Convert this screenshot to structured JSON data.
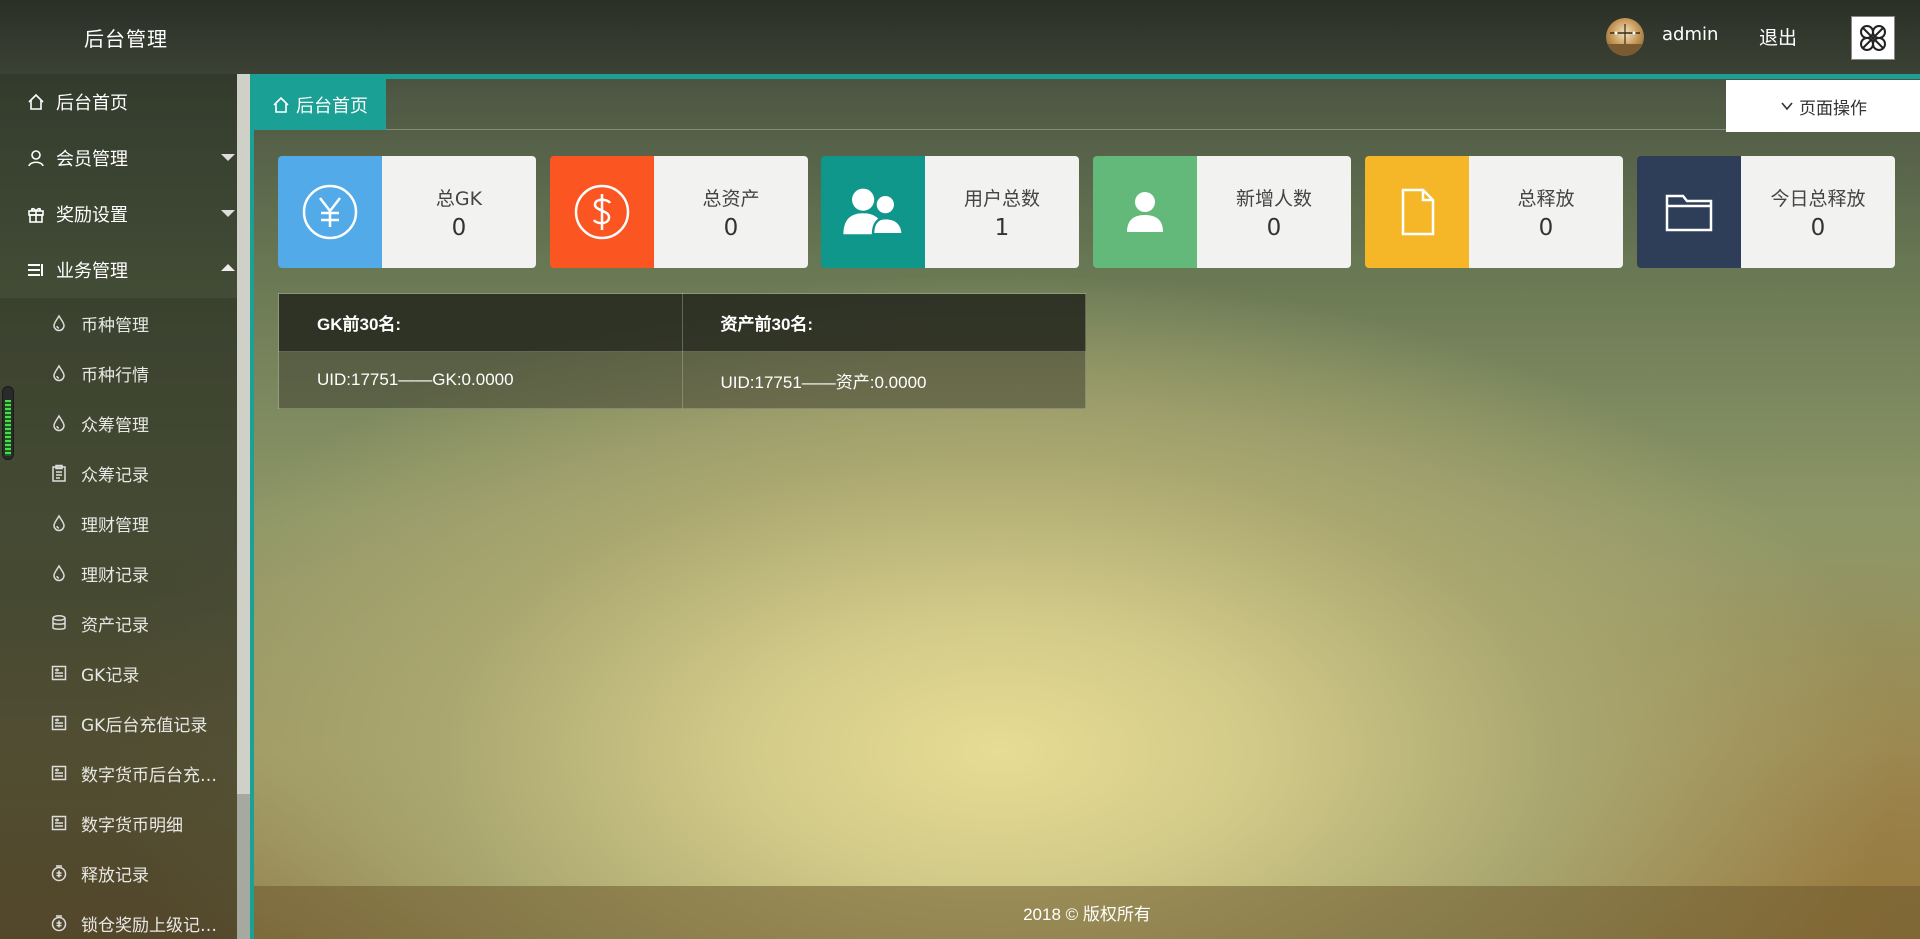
{
  "header": {
    "brand": "后台管理",
    "username": "admin",
    "logout_label": "退出"
  },
  "sidebar": {
    "home_label": "后台首页",
    "groups": [
      {
        "label": "会员管理",
        "icon": "user-icon",
        "expanded": false
      },
      {
        "label": "奖励设置",
        "icon": "gift-icon",
        "expanded": false
      },
      {
        "label": "业务管理",
        "icon": "list-icon",
        "expanded": true
      }
    ],
    "sub_items": [
      {
        "label": "币种管理",
        "icon": "drop-icon"
      },
      {
        "label": "币种行情",
        "icon": "drop-icon"
      },
      {
        "label": "众筹管理",
        "icon": "drop-icon"
      },
      {
        "label": "众筹记录",
        "icon": "clipboard-icon"
      },
      {
        "label": "理财管理",
        "icon": "drop-icon"
      },
      {
        "label": "理财记录",
        "icon": "drop-icon"
      },
      {
        "label": "资产记录",
        "icon": "database-icon"
      },
      {
        "label": "GK记录",
        "icon": "ledger-icon"
      },
      {
        "label": "GK后台充值记录",
        "icon": "ledger-icon"
      },
      {
        "label": "数字货币后台充…",
        "icon": "ledger-icon"
      },
      {
        "label": "数字货币明细",
        "icon": "ledger-icon"
      },
      {
        "label": "释放记录",
        "icon": "coin-icon"
      },
      {
        "label": "锁仓奖励上级记…",
        "icon": "coin-icon"
      }
    ]
  },
  "tabs": {
    "active_label": "后台首页",
    "page_ops_label": "页面操作"
  },
  "stats": [
    {
      "title": "总GK",
      "value": "0",
      "color": "#52abe8",
      "icon": "yen-icon"
    },
    {
      "title": "总资产",
      "value": "0",
      "color": "#fb5522",
      "icon": "dollar-icon"
    },
    {
      "title": "用户总数",
      "value": "1",
      "color": "#0f978c",
      "icon": "users-icon"
    },
    {
      "title": "新增人数",
      "value": "0",
      "color": "#63b979",
      "icon": "user-add-icon"
    },
    {
      "title": "总释放",
      "value": "0",
      "color": "#f5b728",
      "icon": "file-icon"
    },
    {
      "title": "今日总释放",
      "value": "0",
      "color": "#2e3e58",
      "icon": "folder-icon"
    }
  ],
  "ranking": {
    "headers": [
      "GK前30名:",
      "资产前30名:"
    ],
    "rows": [
      [
        "UID:17751——GK:0.0000",
        "UID:17751——资产:0.0000"
      ]
    ]
  },
  "footer": {
    "text": "2018 © 版权所有"
  },
  "colors": {
    "accent": "#1aa094"
  }
}
